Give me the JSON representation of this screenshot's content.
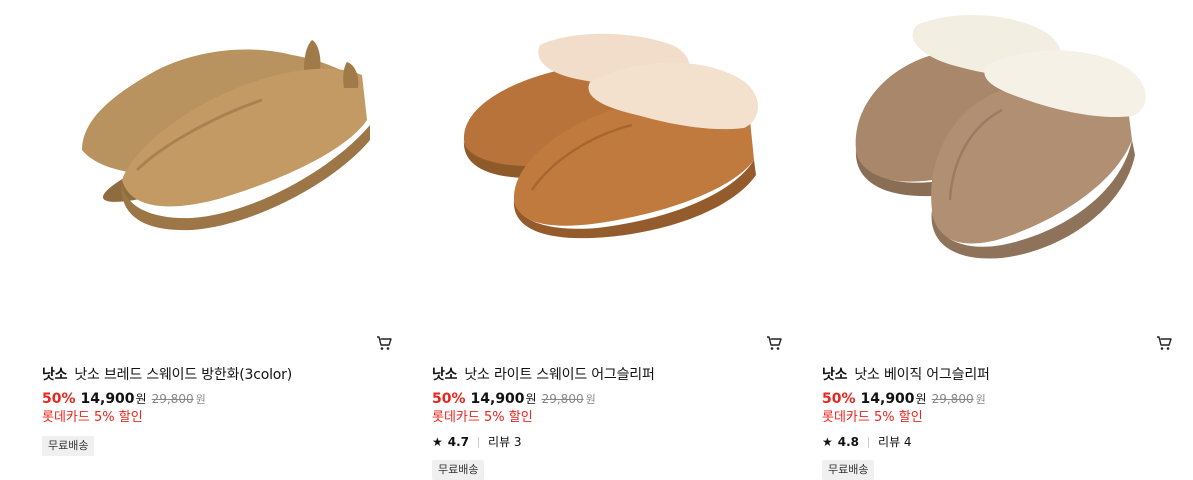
{
  "products": [
    {
      "brand": "낫소",
      "name": "낫소 브레드 스웨이드 방한화(3color)",
      "discount_rate": "50%",
      "price": "14,900",
      "price_unit": "원",
      "original_price": "29,800",
      "original_unit": "원",
      "card_discount": "롯데카드 5% 할인",
      "badge": "무료배송",
      "image_icon": "slipper-closed-back-image",
      "colors": {
        "upper": "#b8925f",
        "sole": "#a07a48"
      }
    },
    {
      "brand": "낫소",
      "name": "낫소 라이트 스웨이드 어그슬리퍼",
      "discount_rate": "50%",
      "price": "14,900",
      "price_unit": "원",
      "original_price": "29,800",
      "original_unit": "원",
      "card_discount": "롯데카드 5% 할인",
      "rating": "4.7",
      "review_label": "리뷰 3",
      "badge": "무료배송",
      "image_icon": "fur-slipper-image",
      "colors": {
        "upper": "#b8733a",
        "sole": "#9a5f2e",
        "fur": "#f1ddc9"
      }
    },
    {
      "brand": "낫소",
      "name": "낫소 베이직 어그슬리퍼",
      "discount_rate": "50%",
      "price": "14,900",
      "price_unit": "원",
      "original_price": "29,800",
      "original_unit": "원",
      "card_discount": "롯데카드 5% 할인",
      "rating": "4.8",
      "review_label": "리뷰 4",
      "badge": "무료배송",
      "image_icon": "fur-slipper-image",
      "colors": {
        "upper": "#a8876b",
        "sole": "#8e7058",
        "fur": "#f3eee2"
      }
    }
  ],
  "icons": {
    "cart": "cart-icon",
    "star": "star-icon"
  },
  "accent": "#e8251e"
}
